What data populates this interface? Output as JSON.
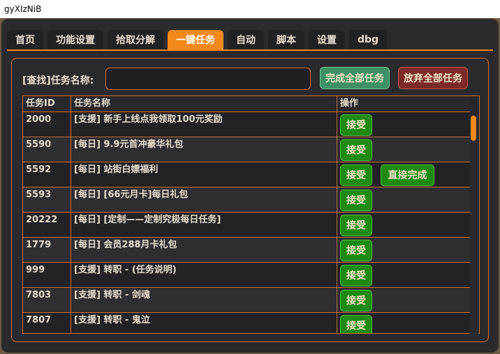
{
  "window": {
    "title": "gyXIzNiB"
  },
  "tabs": [
    {
      "label": "首页"
    },
    {
      "label": "功能设置"
    },
    {
      "label": "拾取分解"
    },
    {
      "label": "一键任务",
      "active": true
    },
    {
      "label": "自动"
    },
    {
      "label": "脚本"
    },
    {
      "label": "设置"
    },
    {
      "label": "dbg"
    }
  ],
  "search": {
    "label": "[查找]任务名称:",
    "value": ""
  },
  "actions": {
    "complete_all": "完成全部任务",
    "abandon_all": "放弃全部任务"
  },
  "table": {
    "headers": [
      "任务ID",
      "任务名称",
      "操作"
    ],
    "rows": [
      {
        "id": "2000",
        "name": "[支援] 新手上线点我领取100元奖励",
        "accept": "接受"
      },
      {
        "id": "5590",
        "name": "[每日] 9.9元首冲豪华礼包",
        "accept": "接受"
      },
      {
        "id": "5592",
        "name": "[每日] 站街白嫖福利",
        "accept": "接受",
        "direct": "直接完成"
      },
      {
        "id": "5593",
        "name": "[每日] [66元月卡]每日礼包",
        "accept": "接受"
      },
      {
        "id": "20222",
        "name": "[每日] [定制——定制究极每日任务]",
        "accept": "接受"
      },
      {
        "id": "1779",
        "name": "[每日] 会员288月卡礼包",
        "accept": "接受"
      },
      {
        "id": "999",
        "name": "[支援] 转职 - (任务说明)",
        "accept": "接受"
      },
      {
        "id": "7803",
        "name": "[支援] 转职 - 剑魂",
        "accept": "接受"
      },
      {
        "id": "7807",
        "name": "[支援] 转职 - 鬼泣",
        "accept": "接受"
      }
    ]
  },
  "colors": {
    "accent": "#f2891a",
    "border": "#c3723a",
    "accept_green": "#1e8a14",
    "complete_green": "#3e8f63",
    "abandon_red": "#7b2b28"
  }
}
